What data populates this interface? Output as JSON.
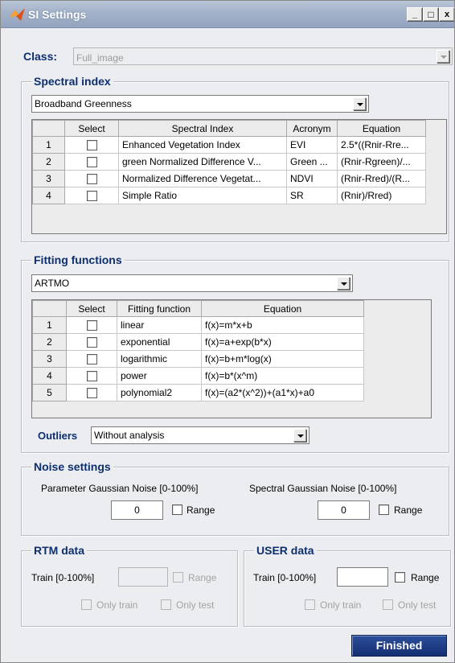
{
  "window": {
    "title": "SI Settings",
    "minimize": "_",
    "maximize": "□",
    "close": "x"
  },
  "class_row": {
    "label": "Class:",
    "value": "Full_image"
  },
  "spectral_index": {
    "legend": "Spectral index",
    "selected": "Broadband Greenness",
    "headers": [
      "Select",
      "Spectral Index",
      "Acronym",
      "Equation"
    ],
    "rows": [
      {
        "num": "1",
        "name": "Enhanced Vegetation Index",
        "acronym": "EVI",
        "equation": "2.5*((Rnir-Rre..."
      },
      {
        "num": "2",
        "name": "green Normalized Difference V...",
        "acronym": "Green ...",
        "equation": "(Rnir-Rgreen)/..."
      },
      {
        "num": "3",
        "name": "Normalized Difference Vegetat...",
        "acronym": "NDVI",
        "equation": "(Rnir-Rred)/(R..."
      },
      {
        "num": "4",
        "name": "Simple Ratio",
        "acronym": "SR",
        "equation": "(Rnir)/Rred)"
      }
    ]
  },
  "fitting_functions": {
    "legend": "Fitting functions",
    "selected": "ARTMO",
    "headers": [
      "Select",
      "Fitting function",
      "Equation"
    ],
    "rows": [
      {
        "num": "1",
        "name": "linear",
        "equation": "f(x)=m*x+b"
      },
      {
        "num": "2",
        "name": "exponential",
        "equation": "f(x)=a+exp(b*x)"
      },
      {
        "num": "3",
        "name": "logarithmic",
        "equation": "f(x)=b+m*log(x)"
      },
      {
        "num": "4",
        "name": "power",
        "equation": "f(x)=b*(x^m)"
      },
      {
        "num": "5",
        "name": "polynomial2",
        "equation": "f(x)=(a2*(x^2))+(a1*x)+a0"
      }
    ],
    "outliers_label": "Outliers",
    "outliers_value": "Without analysis"
  },
  "noise_settings": {
    "legend": "Noise settings",
    "param_label": "Parameter Gaussian Noise  [0-100%]",
    "param_value": "0",
    "param_range": "Range",
    "spectral_label": "Spectral Gaussian Noise  [0-100%]",
    "spectral_value": "0",
    "spectral_range": "Range"
  },
  "rtm_data": {
    "legend": "RTM data",
    "train_label": "Train [0-100%]",
    "train_value": "",
    "range": "Range",
    "only_train": "Only train",
    "only_test": "Only test"
  },
  "user_data": {
    "legend": "USER data",
    "train_label": "Train [0-100%]",
    "train_value": "",
    "range": "Range",
    "only_train": "Only train",
    "only_test": "Only test"
  },
  "finished_button": "Finished"
}
